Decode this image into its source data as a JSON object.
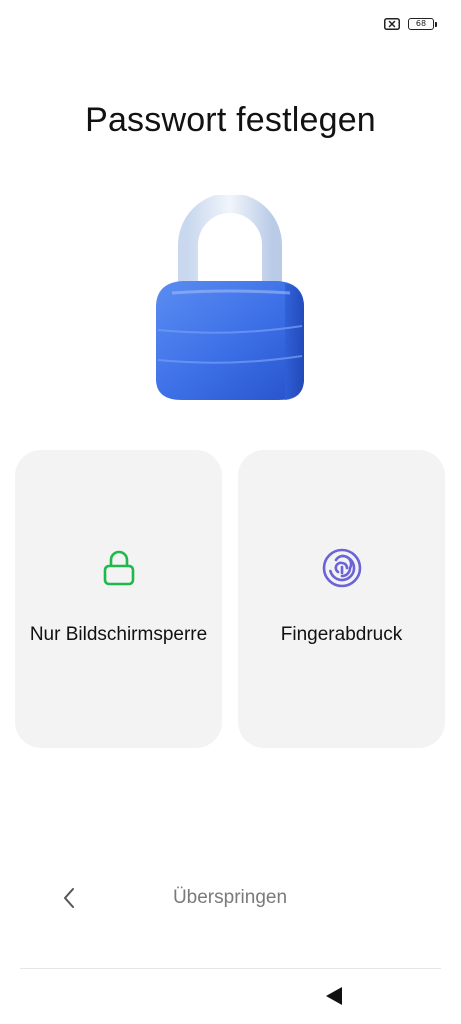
{
  "status_bar": {
    "sim_icon": "sim-no-signal-icon",
    "battery_level": "68"
  },
  "page": {
    "title": "Passwort festlegen",
    "hero_icon": "padlock-illustration"
  },
  "options": [
    {
      "label": "Nur Bildschirmsperre",
      "icon": "lock-icon",
      "icon_color": "#1fb84a"
    },
    {
      "label": "Fingerabdruck",
      "icon": "fingerprint-icon",
      "icon_color": "#6b63d8"
    }
  ],
  "footer": {
    "back_icon": "chevron-left-icon",
    "skip_label": "Überspringen"
  },
  "nav_bar": {
    "back_icon": "triangle-back-icon"
  },
  "colors": {
    "card_background": "#f3f3f3",
    "padlock_body": "#3f73e6",
    "padlock_shackle": "#dde7f4"
  }
}
